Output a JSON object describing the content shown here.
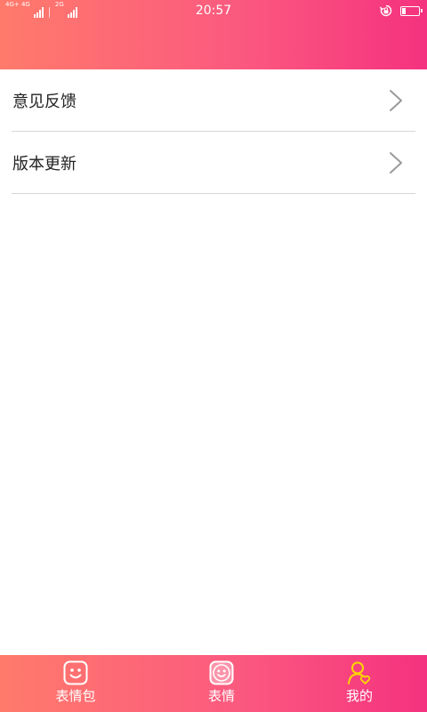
{
  "status_bar": {
    "network_1": "4G+ 4G",
    "network_2": "2G",
    "time": "20:57",
    "battery_level": 0.25
  },
  "menu": {
    "items": [
      {
        "label": "意见反馈"
      },
      {
        "label": "版本更新"
      }
    ]
  },
  "tabbar": {
    "tabs": [
      {
        "label": "表情包",
        "icon": "smiley-face-icon",
        "active": false
      },
      {
        "label": "表情",
        "icon": "smiley-face-icon",
        "active": false
      },
      {
        "label": "我的",
        "icon": "user-heart-icon",
        "active": true
      }
    ]
  },
  "colors": {
    "gradient_start": "#ff7a6b",
    "gradient_end": "#f5327f",
    "active_icon": "#ffd700",
    "divider": "#d6d6d6"
  }
}
